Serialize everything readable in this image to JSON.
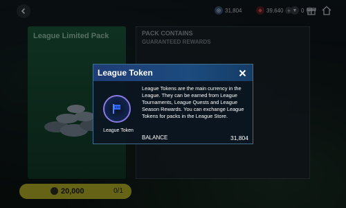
{
  "topbar": {
    "currencies": [
      {
        "icon": "gp-coin-icon",
        "value": "31,804",
        "color": "#5f7fa3",
        "glyph": "◎"
      },
      {
        "icon": "shield-coin-icon",
        "value": "39,640",
        "color": "#c94040",
        "glyph": "◆"
      },
      {
        "icon": "ef-coin-icon",
        "value": "0",
        "color": "#8a8f95",
        "glyph": "▼"
      }
    ],
    "menu_icons": [
      "bell-icon",
      "gift-icon",
      "home-icon"
    ]
  },
  "pack": {
    "title": "League Limited Pack",
    "price": "20,000",
    "count": "0/1",
    "card_color": "#1b5a3c",
    "price_bar_color": "#b9b429"
  },
  "contains": {
    "title": "PACK CONTAINS",
    "subtitle": "GUARANTEED REWARDS"
  },
  "modal": {
    "title": "League Token",
    "close_icon": "close-icon",
    "token_icon": "league-token-icon",
    "token_label": "League Token",
    "description": "League Tokens are the main currency in the League. They can be earned from League Tournaments, League Quests and League Season Rewards. You can exchange League Tokens for packs in the League Store.",
    "balance_label": "BALANCE",
    "balance_value": "31,804",
    "header_color": "#1f3d76",
    "border_color": "#3f6f8e"
  }
}
